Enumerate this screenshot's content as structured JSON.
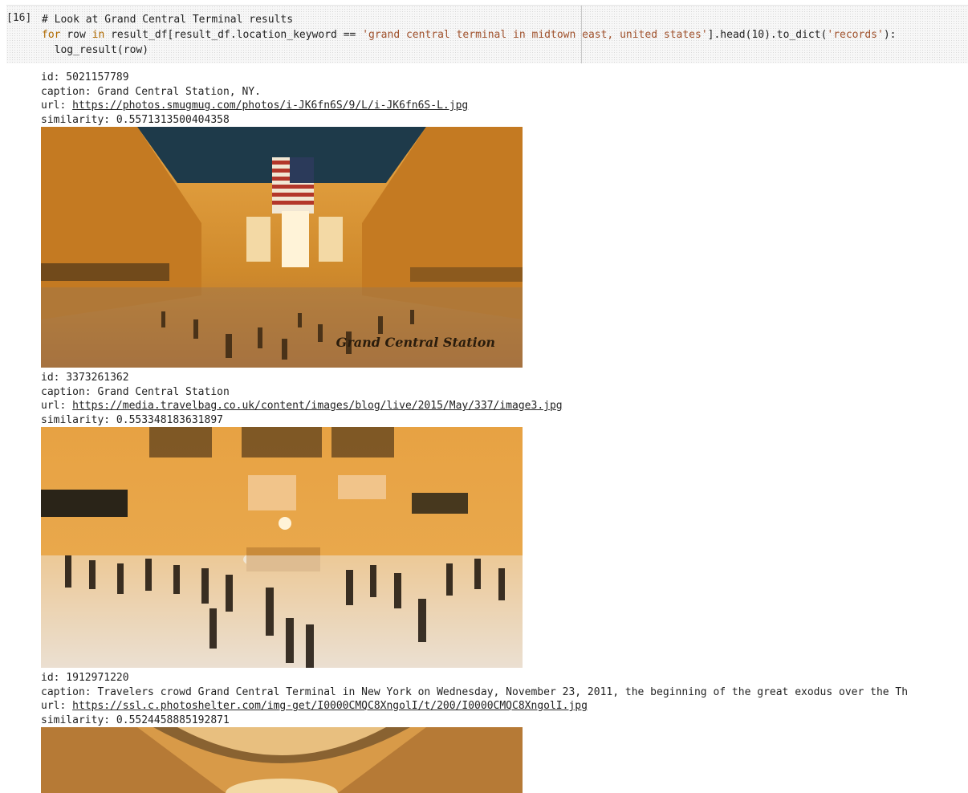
{
  "cell": {
    "prompt": "[16]",
    "comment": "# Look at Grand Central Terminal results",
    "line2_kw1": "for",
    "line2_a": " row ",
    "line2_kw2": "in",
    "line2_b": " result_df[result_df.location_keyword == ",
    "line2_str": "'grand central terminal in midtown east, united states'",
    "line2_c": "].head(10).to_dict(",
    "line2_str2": "'records'",
    "line2_d": "):",
    "line3": "log_result(row)"
  },
  "results": [
    {
      "id": "id: 5021157789",
      "caption": "caption: Grand Central Station, NY.",
      "url_prefix": "url: ",
      "url": "https://photos.smugmug.com/photos/i-JK6fn6S/9/L/i-JK6fn6S-L.jpg",
      "similarity": "similarity: 0.5571313500404358",
      "watermark": "Grand Central Station"
    },
    {
      "id": "id: 3373261362",
      "caption": "caption: Grand Central Station",
      "url_prefix": "url: ",
      "url": "https://media.travelbag.co.uk/content/images/blog/live/2015/May/337/image3.jpg",
      "similarity": "similarity: 0.553348183631897"
    },
    {
      "id": "id: 1912971220",
      "caption": "caption: Travelers crowd Grand Central Terminal in New York on Wednesday, November 23, 2011, the beginning of the great exodus over the Th",
      "url_prefix": "url: ",
      "url": "https://ssl.c.photoshelter.com/img-get/I0000CMQC8XngolI/t/200/I0000CMQC8XngolI.jpg",
      "similarity": "similarity: 0.5524458885192871"
    }
  ],
  "colors": {
    "photo_base": "#d8902f",
    "shadow": "#2a1c0c",
    "ceiling": "#1e3a4a"
  }
}
